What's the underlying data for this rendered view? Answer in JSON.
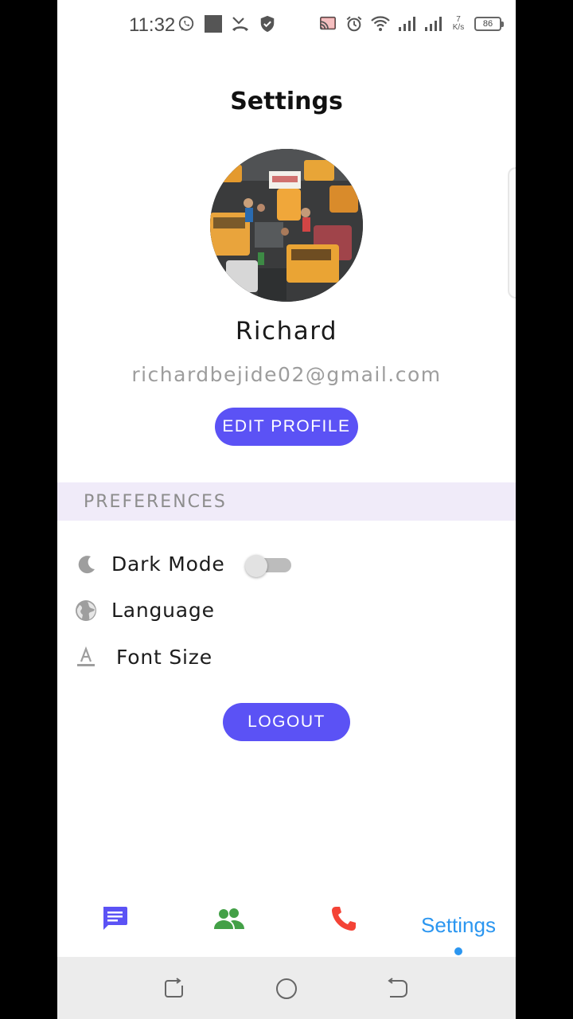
{
  "status_bar": {
    "time": "11:32",
    "net_speed_value": "7",
    "net_speed_unit": "K/s",
    "battery": "86",
    "icons_left": [
      "whatsapp-icon",
      "notification-square-icon",
      "missed-call-icon",
      "shield-icon"
    ],
    "icons_right": [
      "cast-icon",
      "alarm-icon",
      "wifi-icon",
      "signal-icon",
      "signal-icon"
    ]
  },
  "header": {
    "title": "Settings"
  },
  "profile": {
    "name": "Richard",
    "email": "richardbejide02@gmail.com",
    "edit_label": "EDIT PROFILE"
  },
  "preferences": {
    "section_label": "PREFERENCES",
    "items": [
      {
        "label": "Dark Mode",
        "icon": "moon-icon",
        "toggle_on": false
      },
      {
        "label": "Language",
        "icon": "globe-icon"
      },
      {
        "label": "Font Size",
        "icon": "font-size-icon"
      }
    ]
  },
  "actions": {
    "logout_label": "LOGOUT"
  },
  "bottom_nav": {
    "items": [
      {
        "icon": "chat-icon",
        "color": "#5b52f5"
      },
      {
        "icon": "contacts-icon",
        "color": "#43a047"
      },
      {
        "icon": "phone-icon",
        "color": "#f44336"
      },
      {
        "label": "Settings",
        "color": "#2b96f0",
        "active": true
      }
    ]
  },
  "system_nav": {
    "icons": [
      "recent-apps-icon",
      "home-icon",
      "back-icon"
    ]
  },
  "colors": {
    "accent": "#5b52f5",
    "preferences_band": "#f0ebf9",
    "active_nav": "#2b96f0"
  }
}
